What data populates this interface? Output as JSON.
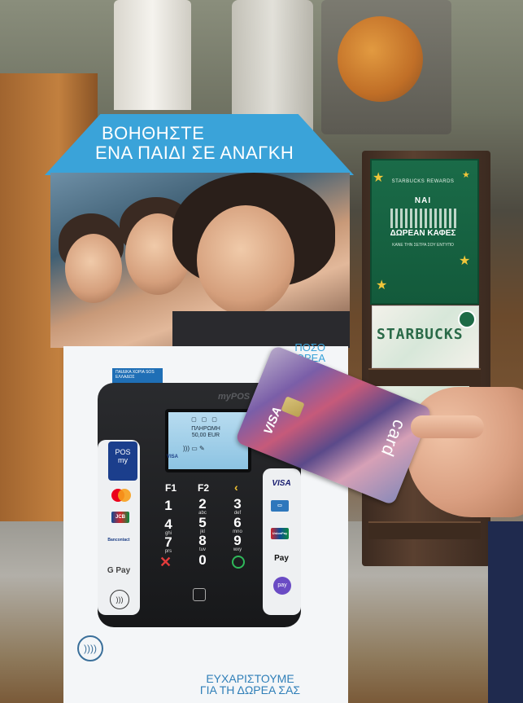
{
  "stand": {
    "headline_line1": "ΒΟΗΘΗΣΤΕ",
    "headline_line2": "ΕΝΑ ΠΑΙΔΙ ΣΕ ΑΝΑΓΚΗ",
    "badge_text": "ΠΑΙΔΙΚΑ ΧΩΡΙΑ SOS ΕΛΛΑΔΟΣ",
    "cut_text_line1": "ΠΟΣΟ",
    "cut_text_line2": "ΔΩΡΕΑ",
    "thanks_line1": "ΕΥΧΑΡΙΣΤΟΥΜΕ",
    "thanks_line2": "ΓΙΑ ΤΗ ΔΩΡΕΑ ΣΑΣ"
  },
  "terminal": {
    "brand": "myPOS",
    "badge_line1": "POS",
    "badge_line2": "my",
    "screen_line1": "ΠΛΗΡΩΜΗ",
    "screen_line2": "50,00 EUR",
    "brands_row": "VISA",
    "f1": "F1",
    "f2": "F2",
    "keys": [
      {
        "num": "1",
        "sub": ""
      },
      {
        "num": "2",
        "sub": "abc"
      },
      {
        "num": "3",
        "sub": "def"
      },
      {
        "num": "4",
        "sub": "ghi"
      },
      {
        "num": "5",
        "sub": "jkl"
      },
      {
        "num": "6",
        "sub": "mno"
      },
      {
        "num": "7",
        "sub": "prs"
      },
      {
        "num": "8",
        "sub": "tuv"
      },
      {
        "num": "9",
        "sub": "wxy"
      },
      {
        "num": "0",
        "sub": ""
      }
    ],
    "left_brands": {
      "jcb": "JCB",
      "bancontact": "Bancontact",
      "gpay": "G Pay"
    },
    "right_brands": {
      "visa": "VISA",
      "unionpay": "UnionPay",
      "applepay": "Pay",
      "pay": "pay"
    }
  },
  "rack": {
    "reward_title": "STARBUCKS REWARDS",
    "reward_yes": "ΝΑΙ",
    "reward_free": "ΔΩΡΕΑΝ ΚΑΦΕΣ",
    "reward_sub": "ΚΑΝΕ ΤΗΝ ΣΕΤΡΑ ΣΟΥ ΕΝΤΥΠΟ",
    "giftcard_word": "STARBUCKS"
  },
  "held_card": {
    "network": "VISA",
    "word": "card"
  }
}
